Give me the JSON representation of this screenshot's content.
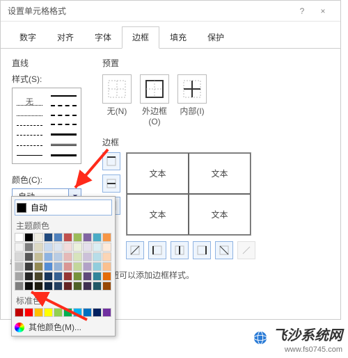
{
  "dialog": {
    "title": "设置单元格格式",
    "help": "?",
    "close": "×"
  },
  "tabs": [
    "数字",
    "对齐",
    "字体",
    "边框",
    "填充",
    "保护"
  ],
  "active_tab_index": 3,
  "line": {
    "section": "直线",
    "style_label": "样式(S):",
    "none_label": "无",
    "color_label": "颜色(C):",
    "color_value": "自动"
  },
  "preset": {
    "section": "预置",
    "labels": [
      "无(N)",
      "外边框(O)",
      "内部(I)"
    ]
  },
  "border": {
    "section": "边框",
    "cell_text": "文本",
    "hint": "安钮可以添加边框样式。"
  },
  "fragment": "单",
  "popup": {
    "auto": "自动",
    "theme_label": "主题颜色",
    "standard_label": "标准色",
    "more": "其他颜色(M)...",
    "theme_colors": [
      "#ffffff",
      "#000000",
      "#eeece1",
      "#1f497d",
      "#4f81bd",
      "#c0504d",
      "#9bbb59",
      "#8064a2",
      "#4bacc6",
      "#f79646",
      "#f2f2f2",
      "#7f7f7f",
      "#ddd9c3",
      "#c6d9f0",
      "#dbe5f1",
      "#f2dcdb",
      "#ebf1dd",
      "#e5e0ec",
      "#dbeef3",
      "#fdeada",
      "#d8d8d8",
      "#595959",
      "#c4bd97",
      "#8db3e2",
      "#b8cce4",
      "#e5b9b7",
      "#d7e3bc",
      "#ccc1d9",
      "#b7dde8",
      "#fbd5b5",
      "#bfbfbf",
      "#3f3f3f",
      "#938953",
      "#548dd4",
      "#95b3d7",
      "#d99694",
      "#c3d69b",
      "#b2a2c7",
      "#92cddc",
      "#fac08f",
      "#a5a5a5",
      "#262626",
      "#494429",
      "#17365d",
      "#366092",
      "#953734",
      "#76923c",
      "#5f497a",
      "#31859b",
      "#e36c09",
      "#7f7f7f",
      "#0c0c0c",
      "#1d1b10",
      "#0f243e",
      "#244061",
      "#632423",
      "#4f6128",
      "#3f3151",
      "#205867",
      "#974806"
    ],
    "standard_colors": [
      "#c00000",
      "#ff0000",
      "#ffc000",
      "#ffff00",
      "#92d050",
      "#00b050",
      "#00b0f0",
      "#0070c0",
      "#002060",
      "#7030a0"
    ]
  },
  "watermark": {
    "name": "飞沙系统网",
    "url": "www.fs0745.com"
  }
}
